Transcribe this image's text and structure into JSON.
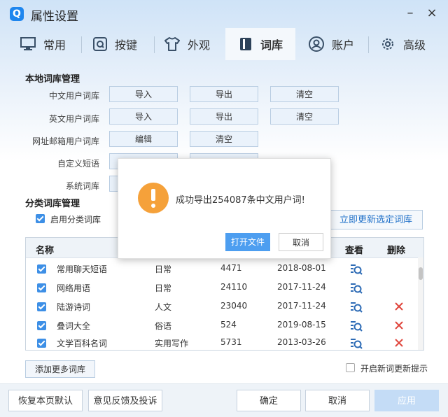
{
  "window": {
    "title": "属性设置",
    "logo_letter": "Q"
  },
  "tabs": [
    {
      "label": "常用",
      "icon": "monitor-icon"
    },
    {
      "label": "按键",
      "icon": "keyboard-icon"
    },
    {
      "label": "外观",
      "icon": "shirt-icon"
    },
    {
      "label": "词库",
      "icon": "book-icon",
      "active": true
    },
    {
      "label": "账户",
      "icon": "user-icon"
    },
    {
      "label": "高级",
      "icon": "gear-icon"
    }
  ],
  "local": {
    "heading": "本地词库管理",
    "rows": [
      {
        "label": "中文用户词库",
        "buttons": [
          "导入",
          "导出",
          "清空"
        ]
      },
      {
        "label": "英文用户词库",
        "buttons": [
          "导入",
          "导出",
          "清空"
        ]
      },
      {
        "label": "网址邮箱用户词库",
        "buttons": [
          "编辑",
          "清空"
        ]
      },
      {
        "label": "自定义短语",
        "buttons": []
      },
      {
        "label": "系统词库",
        "buttons": []
      }
    ]
  },
  "category": {
    "heading": "分类词库管理",
    "enable_label": "启用分类词库",
    "update_button": "立即更新选定词库",
    "columns": [
      "名称",
      "查看",
      "删除"
    ],
    "rows": [
      {
        "name": "常用聊天短语",
        "type": "日常",
        "count": "4471",
        "date": "2018-08-01",
        "deletable": false
      },
      {
        "name": "网络用语",
        "type": "日常",
        "count": "24110",
        "date": "2017-11-24",
        "deletable": false
      },
      {
        "name": "陆游诗词",
        "type": "人文",
        "count": "23040",
        "date": "2017-11-24",
        "deletable": true
      },
      {
        "name": "叠词大全",
        "type": "俗语",
        "count": "524",
        "date": "2019-08-15",
        "deletable": true
      },
      {
        "name": "文学百科名词",
        "type": "实用写作",
        "count": "5731",
        "date": "2013-03-26",
        "deletable": true
      }
    ],
    "add_more_button": "添加更多词库",
    "notify_label": "开启新词更新提示"
  },
  "footer": {
    "restore": "恢复本页默认",
    "feedback": "意见反馈及投诉",
    "ok": "确定",
    "cancel": "取消",
    "apply": "应用"
  },
  "dialog": {
    "message": "成功导出254087条中文用户词!",
    "open_file": "打开文件",
    "cancel": "取消"
  },
  "colors": {
    "accent": "#3d8fe6",
    "warning": "#f5a13a",
    "delete": "#e0473e"
  }
}
